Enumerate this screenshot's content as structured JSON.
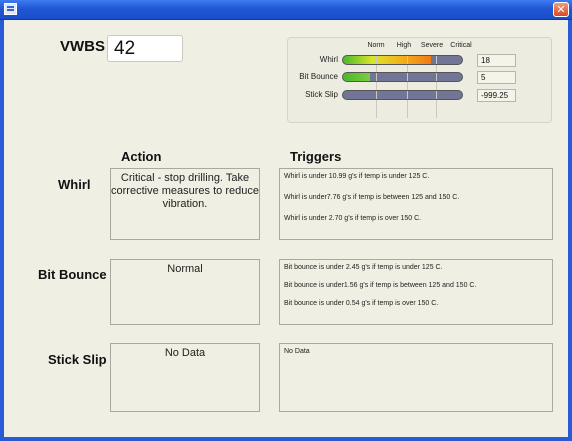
{
  "window": {
    "close_symbol": "✕",
    "accent": "#2a5bd7"
  },
  "vwbs": {
    "label": "VWBS",
    "value": "42"
  },
  "gauges": {
    "levels": [
      "Norm",
      "High",
      "Severe",
      "Critical"
    ],
    "rows": [
      {
        "label": "Whirl",
        "value": "18",
        "fill_fraction": 0.74,
        "fill_colors": [
          "#4ab82c",
          "#d9e52a",
          "#f3b11a",
          "#f07a16"
        ]
      },
      {
        "label": "Bit Bounce",
        "value": "5",
        "fill_fraction": 0.23,
        "fill_colors": [
          "#4ab82c",
          "#7ccd3c"
        ]
      },
      {
        "label": "Stick Slip",
        "value": "-999.25",
        "fill_fraction": 0,
        "fill_colors": []
      }
    ]
  },
  "headers": {
    "action": "Action",
    "triggers": "Triggers"
  },
  "rows": [
    {
      "label": "Whirl",
      "action": "Critical - stop drilling. Take corrective measures to reduce vibration.",
      "triggers": [
        "Whirl is under 10.99 g's if  temp is under 125 C.",
        "Whirl is under7.76 g's if temp is between 125 and 150 C.",
        "Whirl is under 2.70 g's if temp is over 150 C."
      ]
    },
    {
      "label": "Bit Bounce",
      "action": "Normal",
      "triggers": [
        "Bit bounce is under 2.45 g's if  temp is under 125 C.",
        "Bit bounce is under1.56 g's if temp is between 125 and 150 C.",
        "Bit bounce is under 0.54 g's if temp is over 150 C."
      ]
    },
    {
      "label": "Stick Slip",
      "action": "No Data",
      "triggers": [
        "No Data"
      ]
    }
  ]
}
